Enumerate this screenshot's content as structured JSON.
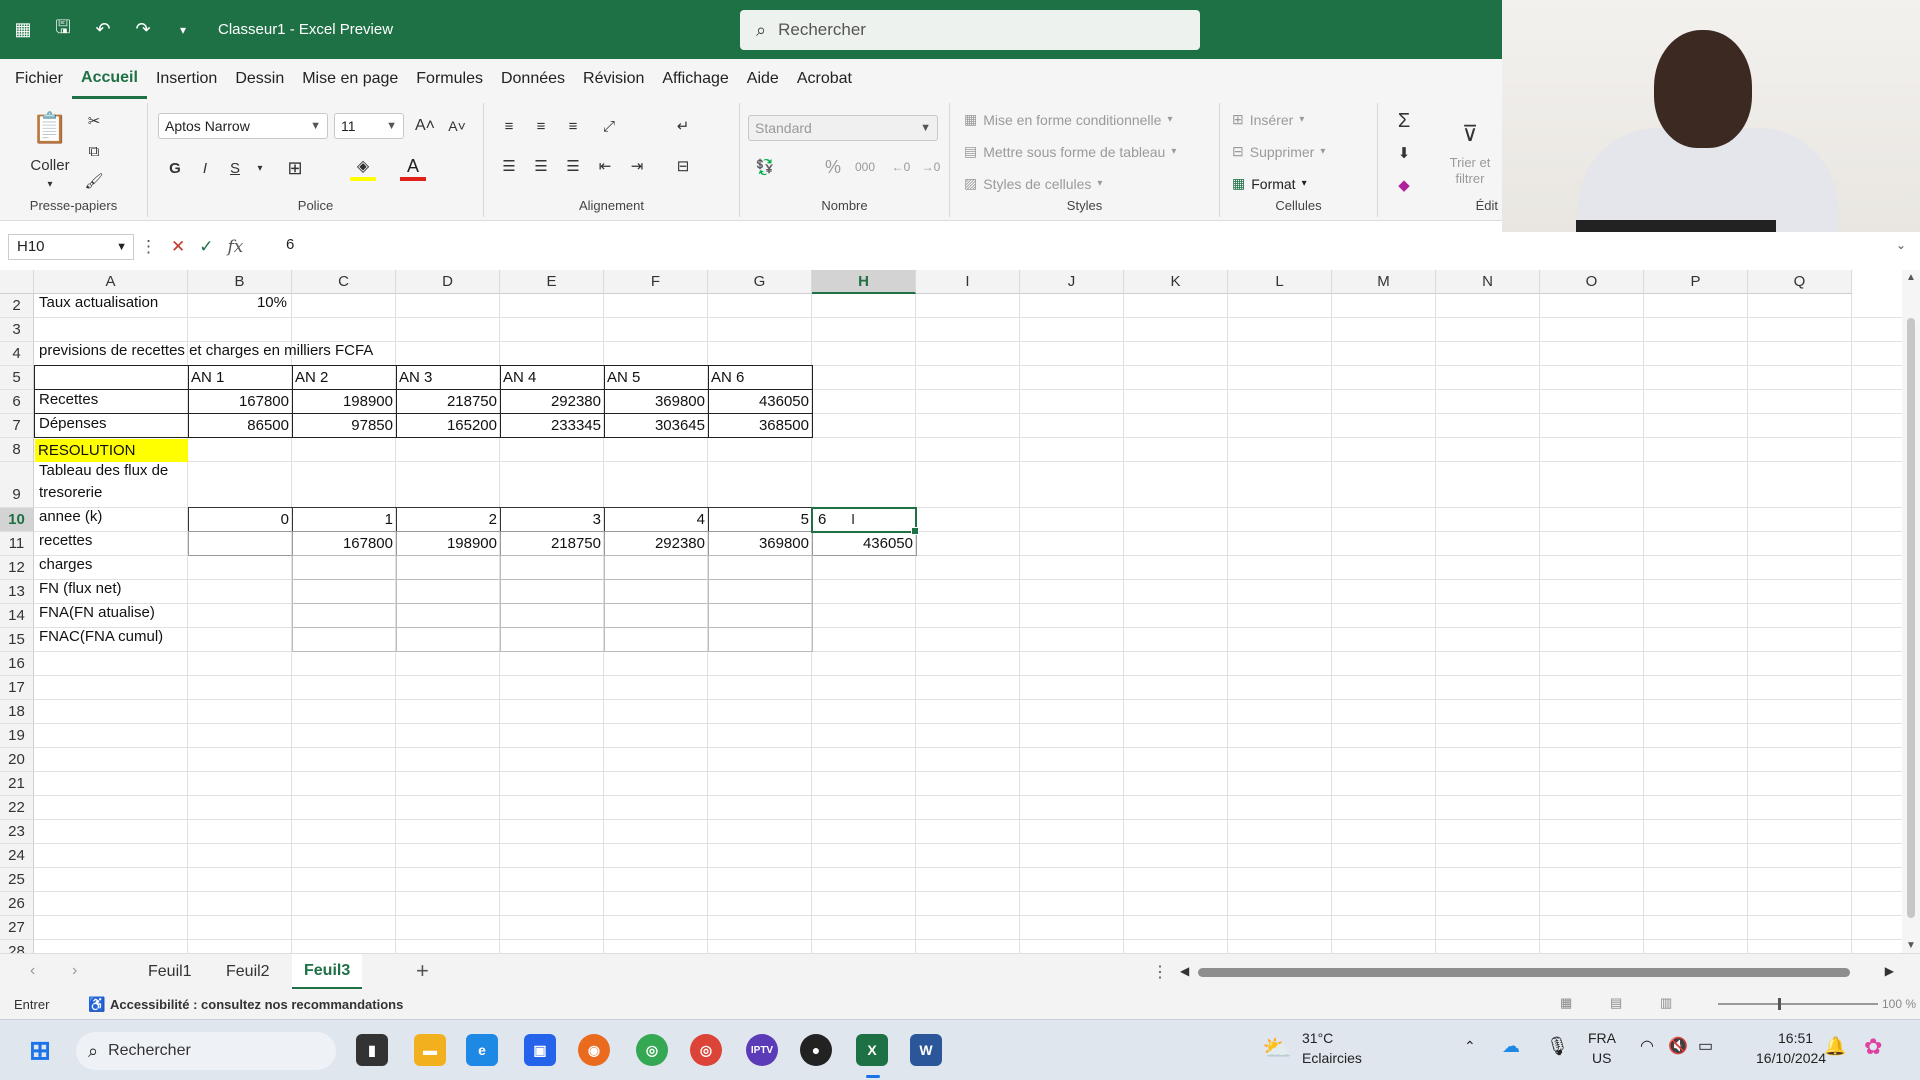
{
  "titlebar": {
    "doc_title": "Classeur1 - Excel Preview",
    "search_placeholder": "Rechercher"
  },
  "menu": {
    "tabs": [
      "Fichier",
      "Accueil",
      "Insertion",
      "Dessin",
      "Mise en page",
      "Formules",
      "Données",
      "Révision",
      "Affichage",
      "Aide",
      "Acrobat"
    ],
    "active": "Accueil"
  },
  "ribbon": {
    "clipboard": {
      "paste": "Coller",
      "label": "Presse-papiers"
    },
    "font": {
      "name": "Aptos Narrow",
      "size": "11",
      "bold": "G",
      "italic": "I",
      "underline": "S",
      "label": "Police"
    },
    "alignment": {
      "label": "Alignement"
    },
    "number": {
      "format": "Standard",
      "label": "Nombre"
    },
    "styles": {
      "conditional": "Mise en forme conditionnelle",
      "as_table": "Mettre sous forme de tableau",
      "cell_styles": "Styles de cellules",
      "label": "Styles"
    },
    "cells": {
      "insert": "Insérer",
      "delete": "Supprimer",
      "format": "Format",
      "label": "Cellules"
    },
    "editing": {
      "sort_filter": "Trier et filtrer",
      "label": "Édit"
    }
  },
  "formula_bar": {
    "name_box": "H10",
    "fx": "fx",
    "value": "6"
  },
  "columns": [
    "A",
    "B",
    "C",
    "D",
    "E",
    "F",
    "G",
    "H",
    "I",
    "J",
    "K",
    "L",
    "M",
    "N",
    "O",
    "P",
    "Q"
  ],
  "selected_column": "H",
  "rows": [
    "2",
    "3",
    "4",
    "5",
    "6",
    "7",
    "8",
    "9",
    "10",
    "11",
    "12",
    "13",
    "14",
    "15",
    "16",
    "17",
    "18",
    "19",
    "20",
    "21",
    "22",
    "23",
    "24",
    "25",
    "26",
    "27",
    "28"
  ],
  "selected_row": "10",
  "sheet": {
    "taux_label": "Taux actualisation",
    "taux_value": "10%",
    "previsions_label": "previsions de recettes et charges en milliers FCFA",
    "years": [
      "AN 1",
      "AN 2",
      "AN 3",
      "AN 4",
      "AN 5",
      "AN 6"
    ],
    "recettes_label": "Recettes",
    "recettes": [
      "167800",
      "198900",
      "218750",
      "292380",
      "369800",
      "436050"
    ],
    "depenses_label": "Dépenses",
    "depenses": [
      "86500",
      "97850",
      "165200",
      "233345",
      "303645",
      "368500"
    ],
    "resolution_label": "RESOLUTION",
    "flux_label_1": "Tableau des flux de",
    "flux_label_2": "tresorerie",
    "annee_label": "annee (k)",
    "annee": [
      "0",
      "1",
      "2",
      "3",
      "4",
      "5"
    ],
    "annee_editing": "6",
    "recettes2_label": "recettes",
    "recettes2": [
      "167800",
      "198900",
      "218750",
      "292380",
      "369800",
      "436050"
    ],
    "charges_label": "charges",
    "fn_label": "FN (flux net)",
    "fna_label": "FNA(FN atualise)",
    "fnac_label": "FNAC(FNA cumul)"
  },
  "sheet_tabs": [
    "Feuil1",
    "Feuil2",
    "Feuil3"
  ],
  "active_sheet": "Feuil3",
  "statusbar": {
    "mode": "Entrer",
    "accessibility": "Accessibilité : consultez nos recommandations",
    "zoom": "100 %"
  },
  "taskbar": {
    "search": "Rechercher",
    "weather_temp": "31°C",
    "weather_desc": "Eclaircies",
    "lang": "FRA",
    "region": "US",
    "time": "16:51",
    "date": "16/10/2024"
  },
  "colors": {
    "excel_green": "#1e7145",
    "highlight_yellow": "#ffff00"
  }
}
